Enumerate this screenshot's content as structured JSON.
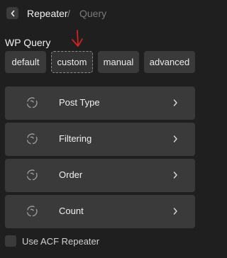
{
  "header": {
    "back_icon": "chevron-left-icon",
    "parent": "Repeater",
    "separator": "/",
    "current": "Query"
  },
  "section": {
    "label": "WP Query"
  },
  "annotation": {
    "icon": "arrow-down-icon",
    "color": "#d9231f"
  },
  "query_modes": {
    "selected": "custom",
    "options": [
      {
        "label": "default"
      },
      {
        "label": "custom"
      },
      {
        "label": "manual"
      },
      {
        "label": "advanced"
      }
    ]
  },
  "settings_rows": [
    {
      "label": "Post Type",
      "icon": "spinner-icon",
      "trailing_icon": "chevron-right-icon"
    },
    {
      "label": "Filtering",
      "icon": "spinner-icon",
      "trailing_icon": "chevron-right-icon"
    },
    {
      "label": "Order",
      "icon": "spinner-icon",
      "trailing_icon": "chevron-right-icon"
    },
    {
      "label": "Count",
      "icon": "spinner-icon",
      "trailing_icon": "chevron-right-icon"
    }
  ],
  "acf_repeater": {
    "label": "Use ACF Repeater",
    "checked": false
  },
  "colors": {
    "background": "#1f1f1f",
    "control": "#3a3a3a",
    "text": "#ececec",
    "muted": "#7a7a7a"
  }
}
